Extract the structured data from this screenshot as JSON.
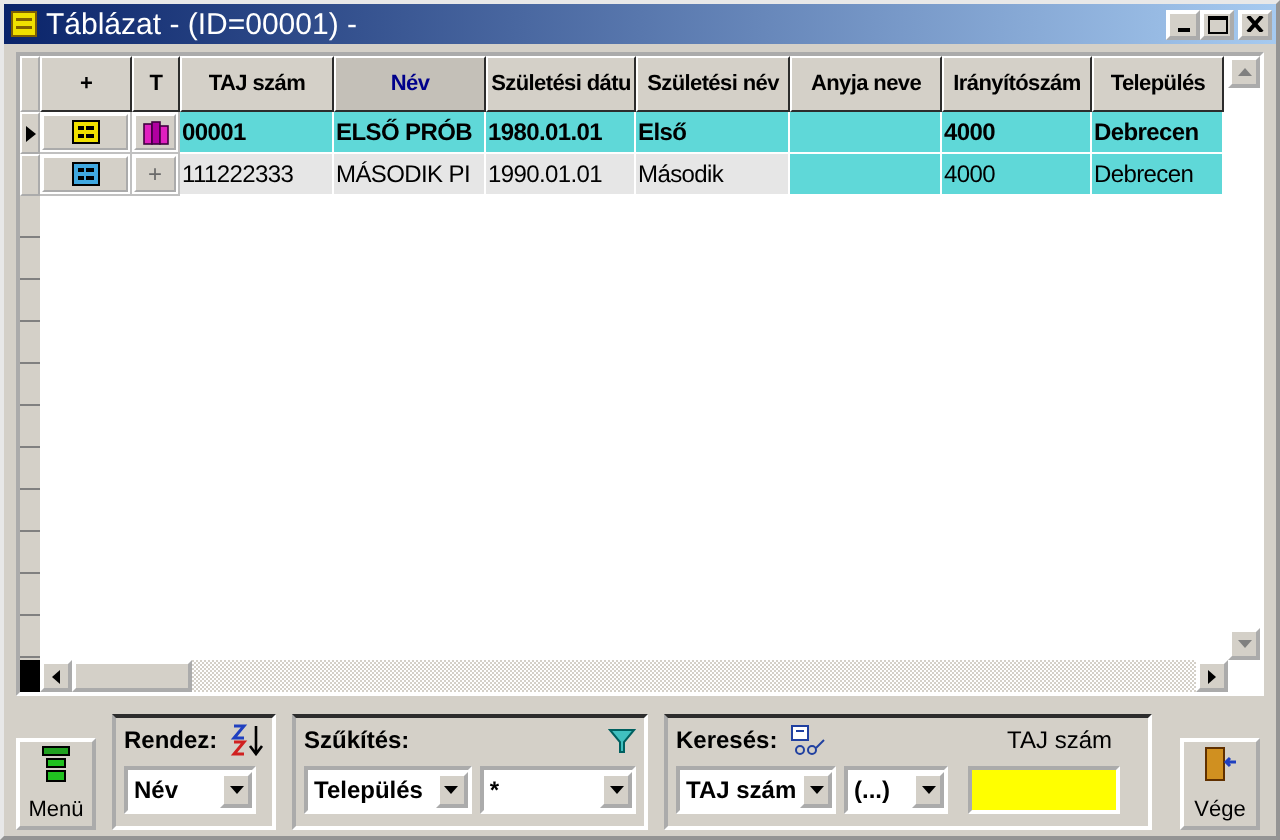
{
  "window": {
    "title": "Táblázat - (ID=00001) -"
  },
  "columns": [
    {
      "label": "+",
      "sorted": false
    },
    {
      "label": "T",
      "sorted": false
    },
    {
      "label": "TAJ szám",
      "sorted": false
    },
    {
      "label": "Név",
      "sorted": true
    },
    {
      "label": "Születési dátu",
      "sorted": false
    },
    {
      "label": "Születési név",
      "sorted": false
    },
    {
      "label": "Anyja neve",
      "sorted": false
    },
    {
      "label": "Irányítószám",
      "sorted": false
    },
    {
      "label": "Település",
      "sorted": false
    }
  ],
  "rows": [
    {
      "selected": true,
      "record_icon": {
        "kind": "highlighted"
      },
      "t_cell": {
        "kind": "icon"
      },
      "cells": [
        "00001",
        "ELSŐ PRÓB",
        "1980.01.01",
        "Első",
        "",
        "4000",
        "Debrecen"
      ]
    },
    {
      "selected": false,
      "record_icon": {
        "kind": "normal"
      },
      "t_cell": {
        "kind": "text",
        "text": "+"
      },
      "cells": [
        "111222333",
        "MÁSODIK PI",
        "1990.01.01",
        "Második",
        "",
        "4000",
        "Debrecen"
      ]
    }
  ],
  "menu_button": "Menü",
  "sort": {
    "label": "Rendez:",
    "value": "Név"
  },
  "filter": {
    "label": "Szűkítés:",
    "field": "Település",
    "value": "*"
  },
  "search": {
    "label": "Keresés:",
    "field": "TAJ szám",
    "operator": "(...)",
    "caption": "TAJ szám"
  },
  "exit_button": "Vége"
}
